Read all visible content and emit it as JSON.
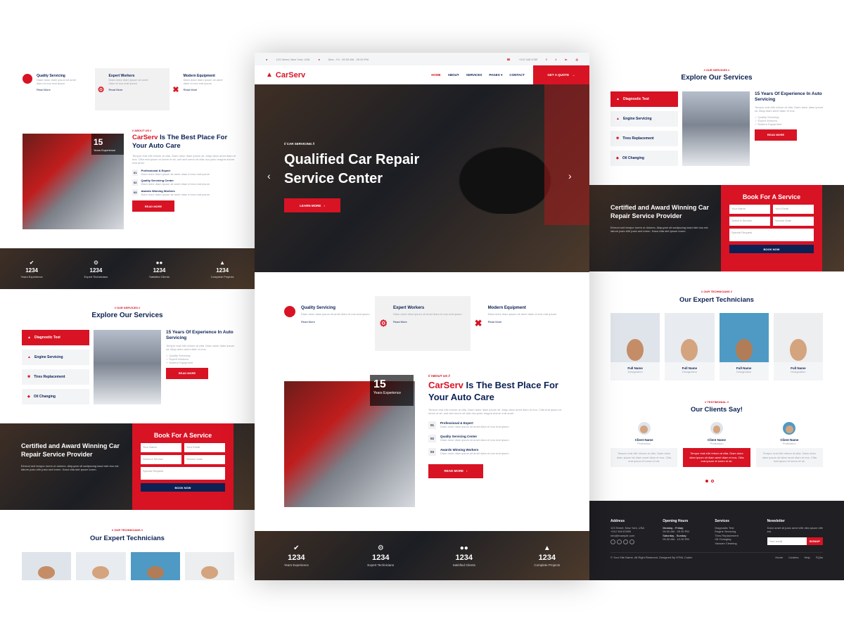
{
  "colors": {
    "accent": "#d81324",
    "navy": "#0b2154",
    "light": "#f3f4f6"
  },
  "topbar": {
    "address": "123 Street, New York, USA",
    "hours": "Mon - Fri : 09.00 AM - 09.00 PM",
    "phone": "+012 345 6789"
  },
  "brand": {
    "name": "CarServ",
    "logo_icon": "car-icon"
  },
  "nav": {
    "items": [
      "HOME",
      "ABOUT",
      "SERVICES",
      "PAGES",
      "CONTACT"
    ],
    "cta": "GET A QUOTE"
  },
  "hero": {
    "kicker": "// CAR SERVICING //",
    "title_line1": "Qualified Car Repair",
    "title_line2": "Service Center",
    "cta": "LEARN MORE"
  },
  "features": [
    {
      "title": "Quality Servicing",
      "text": "Diam dolor diam ipsum sit amet diam et eos erat ipsum",
      "link": "Read More",
      "icon": "certificate-icon"
    },
    {
      "title": "Expert Workers",
      "text": "Diam dolor diam ipsum sit amet diam et eos erat ipsum",
      "link": "Read More",
      "icon": "users-cog-icon"
    },
    {
      "title": "Modern Equipment",
      "text": "Diam dolor diam ipsum sit amet diam et eos erat ipsum",
      "link": "Read More",
      "icon": "tools-icon"
    }
  ],
  "about": {
    "kicker": "// ABOUT US //",
    "title_red": "CarServ",
    "title_rest": " Is The Best Place For Your Auto Care",
    "years": "15",
    "years_label": "Years Experience",
    "text": "Tempor erat elitr rebum at clita. Diam dolor diam ipsum sit. Aliqu diam amet diam et eos. Clita erat ipsum et lorem et sit, sed stet lorem sit clita duo justo magna dolore erat amet",
    "items": [
      {
        "num": "01",
        "title": "Professional & Expert",
        "text": "Diam dolor diam ipsum sit amet diam et eos erat ipsum"
      },
      {
        "num": "02",
        "title": "Quality Servicing Center",
        "text": "Diam dolor diam ipsum sit amet diam et eos erat ipsum"
      },
      {
        "num": "03",
        "title": "Awards Winning Workers",
        "text": "Diam dolor diam ipsum sit amet diam et eos erat ipsum"
      }
    ],
    "cta": "READ MORE"
  },
  "stats": [
    {
      "num": "1234",
      "label": "Years Experience",
      "icon": "check-icon"
    },
    {
      "num": "1234",
      "label": "Expert Technicians",
      "icon": "users-cog-icon"
    },
    {
      "num": "1234",
      "label": "Satisfied Clients",
      "icon": "users-icon"
    },
    {
      "num": "1234",
      "label": "Complete Projects",
      "icon": "car-icon"
    }
  ],
  "services": {
    "kicker": "// OUR SERVICES //",
    "title": "Explore Our Services",
    "tabs": [
      "Diagnostic Test",
      "Engine Servicing",
      "Tires Replacement",
      "Oil Changing"
    ],
    "detail_title": "15 Years Of Experience In Auto Servicing",
    "detail_text": "Tempor erat elitr rebum at clita. Diam dolor diam ipsum sit. Aliqu diam amet diam et eos.",
    "checks": [
      "Quality Servicing",
      "Expert Workers",
      "Modern Equipment"
    ],
    "cta": "READ MORE"
  },
  "booking": {
    "title": "Certified and Award Winning Car Repair Service Provider",
    "text": "Eirmod sed tempor lorem ut dolores. Aliquyam sit sadipscing kasd stet duo est labore justo elitr justo sed lorem. Kasd clita stet ipsum lorem.",
    "form_title": "Book For A Service",
    "fields": [
      "Your Name",
      "Your Email",
      "Select A Service",
      "Service Date",
      "Special Request"
    ],
    "submit": "BOOK NOW"
  },
  "team": {
    "kicker": "// OUR TECHNICIANS //",
    "title": "Our Expert Technicians",
    "members": [
      {
        "name": "Full Name",
        "role": "Designation"
      },
      {
        "name": "Full Name",
        "role": "Designation"
      },
      {
        "name": "Full Name",
        "role": "Designation"
      },
      {
        "name": "Full Name",
        "role": "Designation"
      }
    ]
  },
  "testimonials": {
    "kicker": "// TESTIMONIAL //",
    "title": "Our Clients Say!",
    "clients": [
      {
        "name": "Client Name",
        "role": "Profession",
        "text": "Tempor erat elitr rebum at clita. Diam dolor diam ipsum sit diam amet diam et eos. Clita erat ipsum et lorem et sit."
      },
      {
        "name": "Client Name",
        "role": "Profession",
        "text": "Tempor erat elitr rebum at clita. Diam dolor diam ipsum sit diam amet diam et eos. Clita erat ipsum et lorem et sit."
      },
      {
        "name": "Client Name",
        "role": "Profession",
        "text": "Tempor erat elitr rebum at clita. Diam dolor diam ipsum sit diam amet diam et eos. Clita erat ipsum et lorem et sit."
      }
    ]
  },
  "footer": {
    "address_title": "Address",
    "address_lines": [
      "123 Street, New York, USA",
      "+012 345 67890",
      "info@example.com"
    ],
    "hours_title": "Opening Hours",
    "hours": [
      {
        "day": "Monday - Friday:",
        "time": "09.00 AM - 09.00 PM"
      },
      {
        "day": "Saturday - Sunday:",
        "time": "09.00 AM - 12.00 PM"
      }
    ],
    "services_title": "Services",
    "services": [
      "Diagnostic Test",
      "Engine Servicing",
      "Tires Replacement",
      "Oil Changing",
      "Vacuam Cleaning"
    ],
    "newsletter_title": "Newsletter",
    "newsletter_text": "Dolor amet sit justo amet elitr clita ipsum elitr est.",
    "email_placeholder": "Your email",
    "signup": "SIGNUP",
    "copyright": "© Your Site Name, All Right Reserved. Designed By HTML Codex",
    "links": [
      "Home",
      "Cookies",
      "Help",
      "FQAs"
    ]
  }
}
